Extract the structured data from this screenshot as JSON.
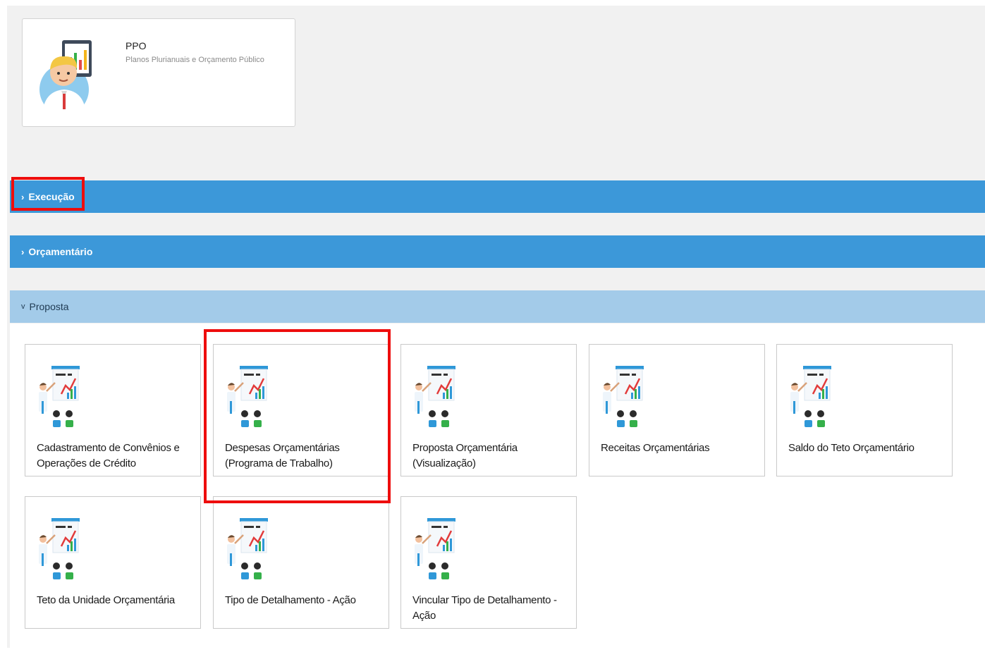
{
  "app": {
    "name": "PPO",
    "description": "Planos Plurianuais e Orçamento Público",
    "avatar_icon": "presenter-avatar-icon"
  },
  "sections": [
    {
      "label": "Execução",
      "state": "collapsed",
      "chevron": "›"
    },
    {
      "label": "Orçamentário",
      "state": "collapsed",
      "chevron": "›"
    },
    {
      "label": "Proposta",
      "state": "expanded",
      "chevron": "v"
    }
  ],
  "proposta_items": [
    {
      "label": "Cadastramento de Convênios e Operações de Crédito",
      "icon": "presentation-icon"
    },
    {
      "label": "Despesas Orçamentárias (Programa de Trabalho)",
      "icon": "presentation-icon"
    },
    {
      "label": "Proposta Orçamentária (Visualização)",
      "icon": "presentation-icon"
    },
    {
      "label": "Receitas Orçamentárias",
      "icon": "presentation-icon"
    },
    {
      "label": "Saldo do Teto Orçamentário",
      "icon": "presentation-icon"
    },
    {
      "label": "Teto da Unidade Orçamentária",
      "icon": "presentation-icon"
    },
    {
      "label": "Tipo de Detalhamento - Ação",
      "icon": "presentation-icon"
    },
    {
      "label": "Vincular Tipo de Detalhamento - Ação",
      "icon": "presentation-icon"
    }
  ],
  "colors": {
    "section_bar": "#3c98d9",
    "section_bar_active": "#a3cbe9",
    "highlight": "#ee0d0d",
    "page_background": "#f1f1f1"
  }
}
